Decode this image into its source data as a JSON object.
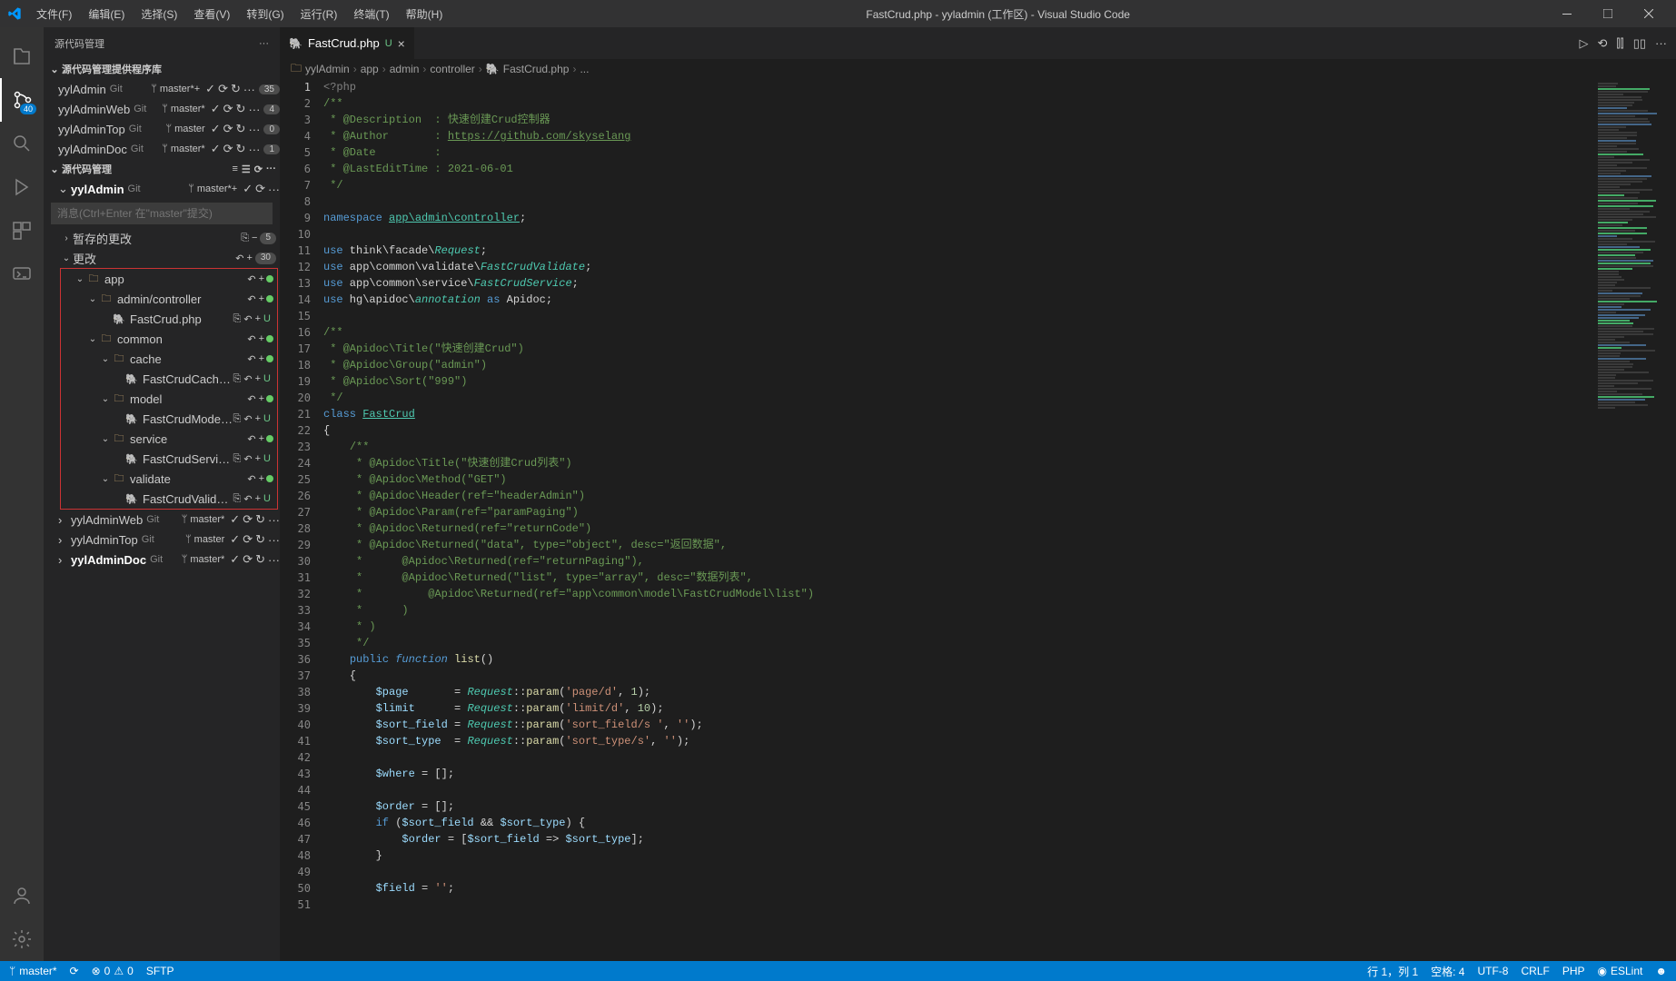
{
  "window": {
    "title": "FastCrud.php - yyladmin (工作区) - Visual Studio Code"
  },
  "menu": {
    "file": "文件(F)",
    "edit": "编辑(E)",
    "select": "选择(S)",
    "view": "查看(V)",
    "goto": "转到(G)",
    "run": "运行(R)",
    "terminal": "终端(T)",
    "help": "帮助(H)"
  },
  "activitybar": {
    "scm_badge": "40"
  },
  "sidebar": {
    "title": "源代码管理",
    "providers_title": "源代码管理提供程序库",
    "repos": [
      {
        "name": "yylAdmin",
        "git": "Git",
        "branch": "master*+",
        "badge": "35"
      },
      {
        "name": "yylAdminWeb",
        "git": "Git",
        "branch": "master*",
        "badge": "4"
      },
      {
        "name": "yylAdminTop",
        "git": "Git",
        "branch": "master",
        "badge": "0"
      },
      {
        "name": "yylAdminDoc",
        "git": "Git",
        "branch": "master*",
        "badge": "1"
      }
    ],
    "scm_title": "源代码管理",
    "active_repo": {
      "name": "yylAdmin",
      "git": "Git",
      "branch": "master*+"
    },
    "commit_placeholder": "消息(Ctrl+Enter 在\"master\"提交)",
    "staged_title": "暂存的更改",
    "changes_title": "更改",
    "changes_count": "30",
    "tree": [
      {
        "indent": 1,
        "type": "folder",
        "open": true,
        "label": "app",
        "status": "dot"
      },
      {
        "indent": 2,
        "type": "folder",
        "open": true,
        "label": "admin/controller",
        "status": "dot"
      },
      {
        "indent": 3,
        "type": "file",
        "label": "FastCrud.php",
        "status": "U"
      },
      {
        "indent": 2,
        "type": "folder",
        "open": true,
        "label": "common",
        "status": "dot"
      },
      {
        "indent": 3,
        "type": "folder",
        "open": true,
        "label": "cache",
        "status": "dot"
      },
      {
        "indent": 4,
        "type": "file",
        "label": "FastCrudCache.php",
        "status": "U"
      },
      {
        "indent": 3,
        "type": "folder",
        "open": true,
        "label": "model",
        "status": "dot"
      },
      {
        "indent": 4,
        "type": "file",
        "label": "FastCrudModel.php",
        "status": "U"
      },
      {
        "indent": 3,
        "type": "folder",
        "open": true,
        "label": "service",
        "status": "dot"
      },
      {
        "indent": 4,
        "type": "file",
        "label": "FastCrudService.php",
        "status": "U"
      },
      {
        "indent": 3,
        "type": "folder",
        "open": true,
        "label": "validate",
        "status": "dot"
      },
      {
        "indent": 4,
        "type": "file",
        "label": "FastCrudValidate.php",
        "status": "U"
      }
    ],
    "other_repos": [
      {
        "name": "yylAdminWeb",
        "git": "Git",
        "branch": "master*"
      },
      {
        "name": "yylAdminTop",
        "git": "Git",
        "branch": "master"
      },
      {
        "name": "yylAdminDoc",
        "git": "Git",
        "branch": "master*"
      }
    ]
  },
  "editor": {
    "tab_name": "FastCrud.php",
    "tab_status": "U",
    "breadcrumbs": [
      "yylAdmin",
      "app",
      "admin",
      "controller",
      "FastCrud.php",
      "..."
    ],
    "staged_badge": "5"
  },
  "statusbar": {
    "branch": "master*",
    "sync": "",
    "errors": "0",
    "warnings": "0",
    "sftp": "SFTP",
    "ln_col": "行 1，列 1",
    "spaces": "空格: 4",
    "encoding": "UTF-8",
    "eol": "CRLF",
    "lang": "PHP",
    "eslint": "ESLint"
  },
  "code": {
    "author_url": "https://github.com/skyselang",
    "date": "2021-06-01"
  }
}
